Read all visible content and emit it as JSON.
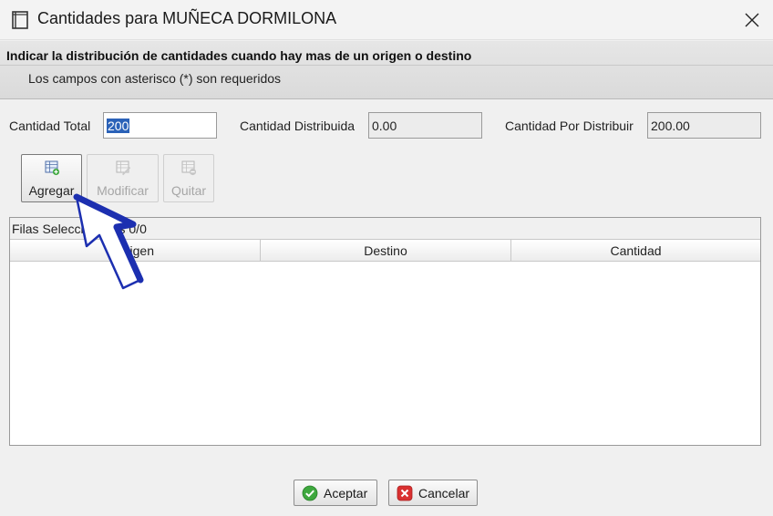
{
  "window": {
    "title": "Cantidades para MUÑECA DORMILONA",
    "app_icon": "window-app-icon",
    "close_icon": "close-icon"
  },
  "header": {
    "title": "Indicar la distribución de cantidades cuando hay mas de un origen o destino",
    "subtitle": "Los campos con asterisco (*) son requeridos"
  },
  "fields": {
    "total_label": "Cantidad Total",
    "total_value": "200",
    "distribuida_label": "Cantidad Distribuida",
    "distribuida_value": "0.00",
    "por_distribuir_label": "Cantidad Por Distribuir",
    "por_distribuir_value": "200.00"
  },
  "toolbar": {
    "agregar_label": "Agregar",
    "modificar_label": "Modificar",
    "quitar_label": "Quitar"
  },
  "table": {
    "status": "Filas Seleccionadas 0/0",
    "columns": [
      "Origen",
      "Destino",
      "Cantidad"
    ],
    "rows": []
  },
  "dialog": {
    "aceptar_label": "Aceptar",
    "cancelar_label": "Cancelar"
  },
  "colors": {
    "selection": "#2b62b8",
    "annotation_arrow": "#1c2fb0",
    "aceptar_icon": "#3ea83e",
    "cancelar_icon": "#d93030"
  }
}
